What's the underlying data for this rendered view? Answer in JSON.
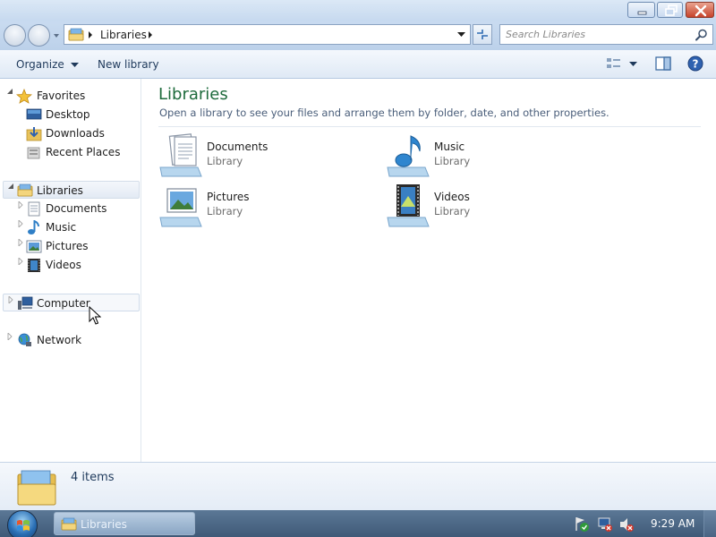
{
  "window": {
    "address": {
      "crumb": "Libraries"
    },
    "search": {
      "placeholder": "Search Libraries"
    }
  },
  "toolbar": {
    "organize_label": "Organize",
    "new_library_label": "New library"
  },
  "nav": {
    "favorites": {
      "label": "Favorites",
      "items": [
        {
          "label": "Desktop",
          "icon": "desktop-icon"
        },
        {
          "label": "Downloads",
          "icon": "downloads-icon"
        },
        {
          "label": "Recent Places",
          "icon": "recent-places-icon"
        }
      ]
    },
    "libraries": {
      "label": "Libraries",
      "items": [
        {
          "label": "Documents",
          "icon": "documents-icon"
        },
        {
          "label": "Music",
          "icon": "music-icon"
        },
        {
          "label": "Pictures",
          "icon": "pictures-icon"
        },
        {
          "label": "Videos",
          "icon": "videos-icon"
        }
      ]
    },
    "computer": {
      "label": "Computer"
    },
    "network": {
      "label": "Network"
    }
  },
  "main": {
    "title": "Libraries",
    "subtitle": "Open a library to see your files and arrange them by folder, date, and other properties.",
    "libraries": [
      {
        "name": "Documents",
        "type": "Library",
        "icon": "documents-library-icon"
      },
      {
        "name": "Music",
        "type": "Library",
        "icon": "music-library-icon"
      },
      {
        "name": "Pictures",
        "type": "Library",
        "icon": "pictures-library-icon"
      },
      {
        "name": "Videos",
        "type": "Library",
        "icon": "videos-library-icon"
      }
    ]
  },
  "details": {
    "item_count": "4 items"
  },
  "taskbar": {
    "window_button_label": "Libraries",
    "clock": "9:29 AM"
  },
  "colors": {
    "title_green": "#1e6b3c",
    "selection_blue": "#e3eaf4",
    "taskbar": "#4b6787"
  }
}
